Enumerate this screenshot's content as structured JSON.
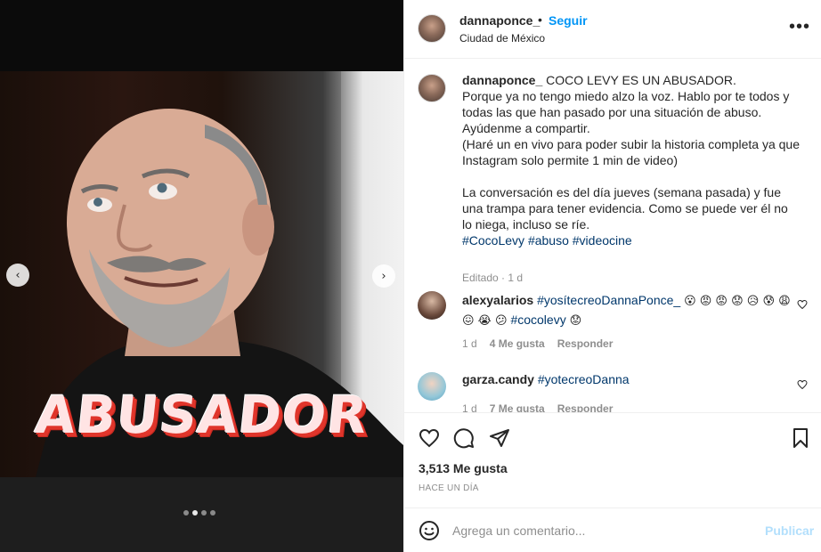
{
  "header": {
    "username": "dannaponce_",
    "separator": "•",
    "follow_label": "Seguir",
    "location": "Ciudad de México",
    "more_icon": "more-horizontal-icon",
    "more_glyph": "•••"
  },
  "media": {
    "overlay_text": "ABUSADOR",
    "prev_glyph": "‹",
    "next_glyph": "›",
    "carousel": {
      "count": 4,
      "active_index": 1
    }
  },
  "caption": {
    "username": "dannaponce_",
    "text": " COCO LEVY ES UN ABUSADOR.\nPorque ya no tengo miedo alzo la voz. Hablo por te todos y todas las que han pasado por una situación de abuso. Ayúdenme a compartir.\n(Haré un en vivo para poder subir la historia completa ya que Instagram solo permite 1 min de video)\n\nLa conversación es del día jueves (semana pasada) y fue una trampa para tener evidencia. Como se puede ver él no lo niega, incluso se ríe.\n",
    "hashtags": [
      "#CocoLevy",
      "#abuso",
      "#videocine"
    ],
    "meta": "Editado · 1 d"
  },
  "comments": [
    {
      "username": "alexyalarios",
      "tag": "#yosítecreoDannaPonce_",
      "emojis_1": "😮 😡 😡 😟 😥 😰 😩",
      "emojis_2": "😖 😭 😕",
      "tag_2": "#cocolevy",
      "emojis_3": "😟",
      "time": "1 d",
      "likes": "4 Me gusta",
      "reply": "Responder"
    },
    {
      "username": "garza.candy",
      "tag": "#yotecreoDanna",
      "time": "1 d",
      "likes": "7 Me gusta",
      "reply": "Responder"
    }
  ],
  "actions": {
    "likes_count": "3,513",
    "likes_label": " Me gusta",
    "time_ago": "Hace un día"
  },
  "add_comment": {
    "placeholder": "Agrega un comentario...",
    "publish_label": "Publicar"
  },
  "colors": {
    "accent": "#0095f6",
    "hashtag": "#00376b",
    "muted": "#8e8e8e",
    "publish_disabled": "#b2dffc",
    "overlay_red": "#e0352b"
  }
}
